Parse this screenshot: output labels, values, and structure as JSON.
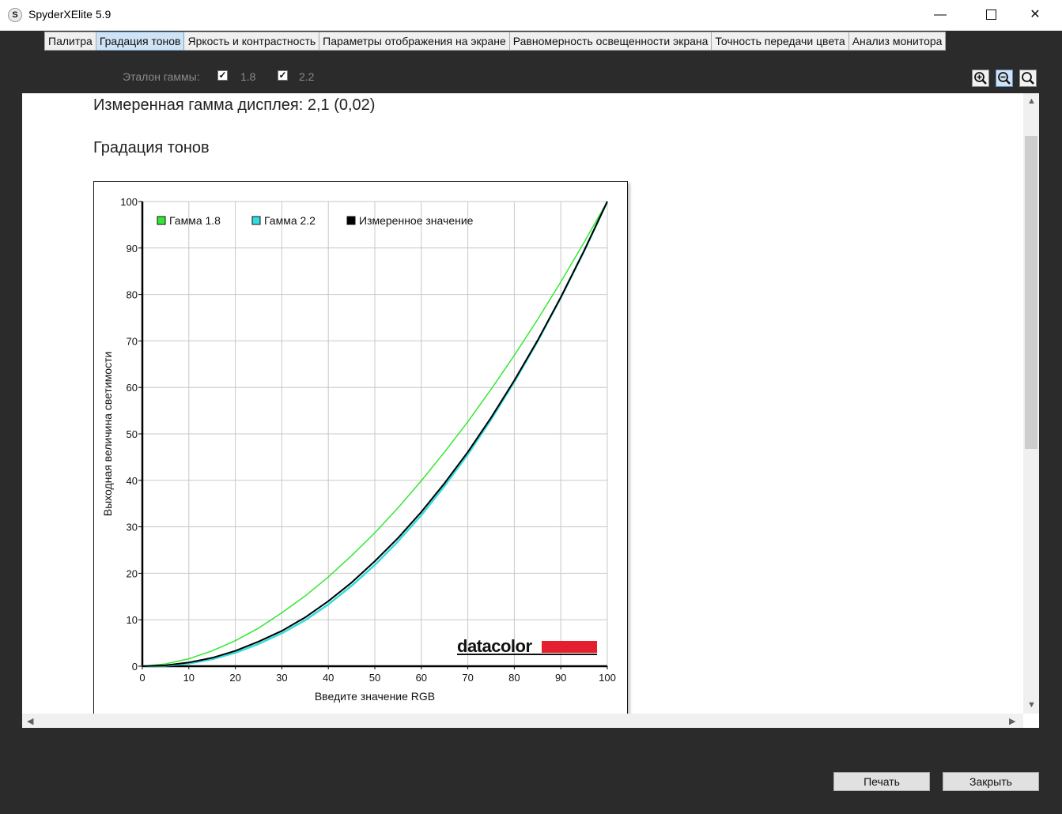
{
  "window": {
    "title": "SpyderXElite 5.9",
    "app_icon_glyph": "S",
    "minimize_glyph": "—",
    "close_glyph": "✕"
  },
  "tabs": [
    {
      "label": "Палитра"
    },
    {
      "label": "Градация тонов",
      "active": true
    },
    {
      "label": "Яркость и контрастность"
    },
    {
      "label": "Параметры отображения на экране"
    },
    {
      "label": "Равномерность освещенности экрана"
    },
    {
      "label": "Точность передачи цвета"
    },
    {
      "label": "Анализ монитора"
    }
  ],
  "toolbar": {
    "gamma_label": "Эталон гаммы:",
    "gamma_18_label": "1.8",
    "gamma_22_label": "2.2",
    "gamma_18_checked": true,
    "gamma_22_checked": true,
    "check_glyph": "✓",
    "zoom_icons": [
      "zoom-in-icon",
      "zoom-out-icon",
      "zoom-fit-icon"
    ]
  },
  "content": {
    "measured_text": "Измеренная гамма дисплея: 2,1 (0,02)",
    "section_title": "Градация тонов",
    "logo_text": "datacolor"
  },
  "chart_data": {
    "type": "line",
    "xlabel": "Введите значение RGB",
    "ylabel": "Выходная величина светимости",
    "xlim": [
      0,
      100
    ],
    "ylim": [
      0,
      100
    ],
    "x_ticks": [
      0,
      10,
      20,
      30,
      40,
      50,
      60,
      70,
      80,
      90,
      100
    ],
    "y_ticks": [
      0,
      10,
      20,
      30,
      40,
      50,
      60,
      70,
      80,
      90,
      100
    ],
    "grid": true,
    "legend_position": "top-left",
    "x": [
      0,
      5,
      10,
      15,
      20,
      25,
      30,
      35,
      40,
      45,
      50,
      55,
      60,
      65,
      70,
      75,
      80,
      85,
      90,
      95,
      100
    ],
    "series": [
      {
        "name": "Гамма 1.8",
        "color": "#33e833",
        "values": [
          0,
          0.5,
          1.6,
          3.3,
          5.5,
          8.2,
          11.5,
          15.1,
          19.2,
          23.8,
          28.7,
          34.1,
          39.9,
          46.1,
          52.6,
          59.6,
          66.9,
          74.6,
          82.7,
          91.2,
          100
        ]
      },
      {
        "name": "Гамма 2.2",
        "color": "#33dddd",
        "values": [
          0,
          0.1,
          0.6,
          1.5,
          2.9,
          4.8,
          7.1,
          9.9,
          13.3,
          17.3,
          21.8,
          26.9,
          32.5,
          38.8,
          45.6,
          53.1,
          61.2,
          69.9,
          79.3,
          89.3,
          100
        ]
      },
      {
        "name": "Измеренное значение",
        "color": "#000000",
        "values": [
          0,
          0.2,
          0.8,
          1.8,
          3.3,
          5.3,
          7.6,
          10.5,
          14.0,
          18.0,
          22.6,
          27.6,
          33.2,
          39.4,
          46.1,
          53.5,
          61.5,
          70.1,
          79.4,
          89.4,
          100
        ]
      }
    ]
  },
  "buttons": {
    "print": "Печать",
    "close": "Закрыть"
  },
  "colors": {
    "frame": "#2b2b2b",
    "tab_active": "#cfe3f5",
    "logo_bar": "#e5202e"
  }
}
